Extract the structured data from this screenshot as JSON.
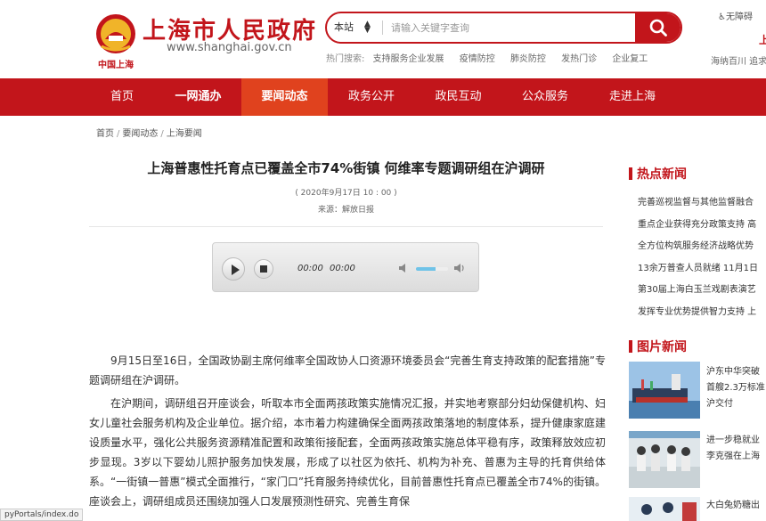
{
  "header": {
    "logo_caption": "中国上海",
    "site_title": "上海市人民政府",
    "site_url": "www.shanghai.gov.cn",
    "barrier_free": "无障碍",
    "right_red_fragment": "上",
    "right_motto": "海纳百川 追求"
  },
  "search": {
    "scope": "本站",
    "placeholder": "请输入关键字查询",
    "hot_label": "热门搜索:",
    "hot_terms": [
      "支持服务企业发展",
      "疫情防控",
      "肺炎防控",
      "发热门诊",
      "企业复工"
    ]
  },
  "nav": {
    "items": [
      "首页",
      "一网通办",
      "要闻动态",
      "政务公开",
      "政民互动",
      "公众服务",
      "走进上海"
    ]
  },
  "breadcrumb": [
    "首页",
    "要闻动态",
    "上海要闻"
  ],
  "article": {
    "title": "上海普惠性托育点已覆盖全市74%街镇 何维率专题调研组在沪调研",
    "date": "( 2020年9月17日 10 : 00 )",
    "source": "来源：解放日报",
    "player": {
      "current_time": "00:00",
      "duration": "00:00",
      "volume_fraction": 0.6
    },
    "paragraphs": [
      "9月15日至16日，全国政协副主席何维率全国政协人口资源环境委员会“完善生育支持政策的配套措施”专题调研组在沪调研。",
      "在沪期间，调研组召开座谈会，听取本市全面两孩政策实施情况汇报，并实地考察部分妇幼保健机构、妇女儿童社会服务机构及企业单位。据介绍，本市着力构建确保全面两孩政策落地的制度体系，提升健康家庭建设质量水平，强化公共服务资源精准配置和政策衔接配套，全面两孩政策实施总体平稳有序，政策释放效应初步显现。3岁以下婴幼儿照护服务加快发展，形成了以社区为依托、机构为补充、普惠为主导的托育供给体系。“一街镇一普惠”模式全面推行，“家门口”托育服务持续优化，目前普惠性托育点已覆盖全市74%的街镇。座谈会上，调研组成员还围绕加强人口发展预测性研究、完善生育保"
    ]
  },
  "status_url": "pyPortals/index.do",
  "sidebar": {
    "hot_news_title": "热点新闻",
    "hot_news": [
      "完善巡视监督与其他监督融合",
      "重点企业获得充分政策支持 高",
      "全方位构筑服务经济战略优势",
      "13余万普查人员就绪 11月1日",
      "第30届上海白玉兰戏剧表演艺",
      "发挥专业优势提供智力支持 上"
    ],
    "photo_news_title": "图片新闻",
    "photo_news": [
      {
        "lines": [
          "沪东中华突破",
          "首艘2.3万标准",
          "沪交付"
        ]
      },
      {
        "lines": [
          "进一步稳就业",
          "李克强在上海"
        ]
      },
      {
        "lines": [
          "大白兔奶糖出"
        ]
      }
    ]
  },
  "colors": {
    "brand_red": "#c2151b",
    "nav_active": "#e0421e"
  }
}
